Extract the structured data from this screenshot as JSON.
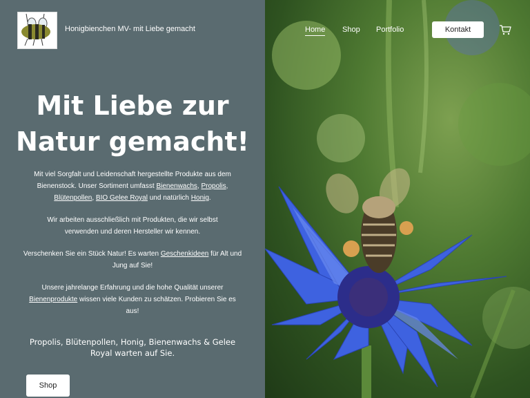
{
  "header": {
    "site_title": "Honigbienchen MV- mit Liebe gemacht",
    "nav": [
      {
        "label": "Home",
        "active": true
      },
      {
        "label": "Shop",
        "active": false
      },
      {
        "label": "Portfolio",
        "active": false
      }
    ],
    "contact_label": "Kontakt"
  },
  "hero": {
    "headline_line1": "Mit Liebe zur",
    "headline_line2": "Natur gemacht!",
    "p1": {
      "t1": "Mit viel Sorgfalt und Leidenschaft hergestellte Produkte aus dem Bienenstock. Unser Sortiment umfasst ",
      "link1": "Bienenwachs",
      "t2": ", ",
      "link2": "Propolis",
      "t3": ", ",
      "link3": "Blütenpollen",
      "t4": ", ",
      "link4": "BIO Gelee Royal",
      "t5": " und natürlich ",
      "link5": "Honig",
      "t6": "."
    },
    "p2": "Wir arbeiten ausschließlich mit Produkten, die wir selbst verwenden und deren Hersteller wir kennen.",
    "p3": {
      "t1": "Verschenken Sie ein Stück Natur! Es warten ",
      "link": "Geschenkideen",
      "t2": " für Alt und Jung auf Sie!"
    },
    "p4": {
      "t1": "Unsere jahrelange Erfahrung und die hohe Qualität unserer ",
      "link": "Bienenprodukte",
      "t2": " wissen viele Kunden zu schätzen. Probieren Sie es aus!"
    },
    "tagline": "Propolis, Blütenpollen, Honig, Bienenwachs & Gelee Royal warten auf Sie.",
    "shop_label": "Shop"
  },
  "colors": {
    "panel": "#5a6b70",
    "button_bg": "#ffffff",
    "flower": "#3a5bd9"
  },
  "icons": {
    "cart": "shopping-cart-icon",
    "logo": "bee-logo"
  }
}
